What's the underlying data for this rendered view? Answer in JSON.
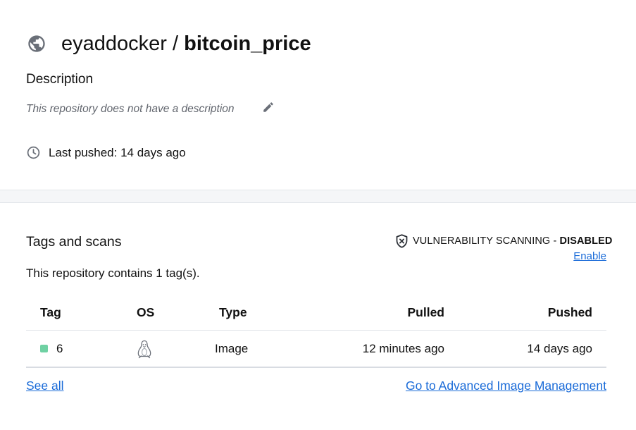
{
  "header": {
    "namespace": "eyaddocker /",
    "repo_name": "bitcoin_price",
    "visibility_icon": "globe-icon"
  },
  "description": {
    "heading": "Description",
    "text": "This repository does not have a description",
    "edit_icon": "pencil-icon"
  },
  "last_pushed": {
    "icon": "clock-icon",
    "text": "Last pushed: 14 days ago"
  },
  "tags_section": {
    "heading": "Tags and scans",
    "vuln_label": "VULNERABILITY SCANNING - ",
    "vuln_status": "DISABLED",
    "enable_link": "Enable",
    "summary": "This repository contains 1 tag(s).",
    "columns": [
      "Tag",
      "OS",
      "Type",
      "Pulled",
      "Pushed"
    ],
    "rows": [
      {
        "tag": "6",
        "os_icon": "linux-icon",
        "type": "Image",
        "pulled": "12 minutes ago",
        "pushed": "14 days ago",
        "status_color": "#6fd1a3"
      }
    ],
    "see_all_link": "See all",
    "advanced_link": "Go to Advanced Image Management"
  },
  "colors": {
    "link": "#1a6bd8",
    "muted_text": "#62666e",
    "divider": "#e2e5ea",
    "page_background": "#f5f6f8"
  }
}
